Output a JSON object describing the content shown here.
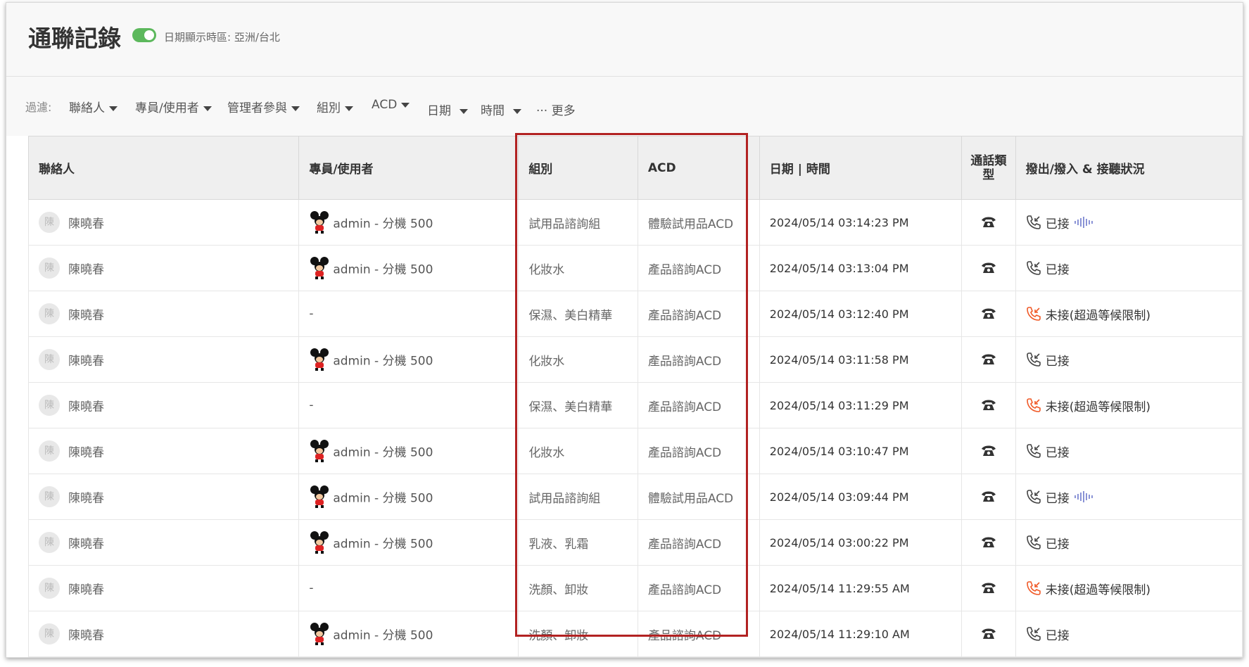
{
  "header": {
    "title": "通聯記錄",
    "timezone_label": "日期顯示時區: 亞洲/台北"
  },
  "filters": {
    "label": "過濾:",
    "items": [
      "聯絡人",
      "專員/使用者",
      "管理者參與",
      "組別",
      "ACD",
      "日期",
      "時間"
    ],
    "more": "··· 更多"
  },
  "table": {
    "columns": [
      "聯絡人",
      "專員/使用者",
      "組別",
      "ACD",
      "日期 | 時間",
      "通話類型",
      "撥出/撥入 & 接聽狀況"
    ],
    "rows": [
      {
        "avatar": "陳",
        "contact": "陳曉春",
        "agent": "admin - 分機 500",
        "has_agent_icon": true,
        "group": "試用品諮詢組",
        "acd": "體驗試用品ACD",
        "datetime": "2024/05/14 03:14:23 PM",
        "status": "已接",
        "missed": false,
        "recording": true
      },
      {
        "avatar": "陳",
        "contact": "陳曉春",
        "agent": "admin - 分機 500",
        "has_agent_icon": true,
        "group": "化妝水",
        "acd": "產品諮詢ACD",
        "datetime": "2024/05/14 03:13:04 PM",
        "status": "已接",
        "missed": false,
        "recording": false
      },
      {
        "avatar": "陳",
        "contact": "陳曉春",
        "agent": "-",
        "has_agent_icon": false,
        "group": "保濕、美白精華",
        "acd": "產品諮詢ACD",
        "datetime": "2024/05/14 03:12:40 PM",
        "status": "未接(超過等候限制)",
        "missed": true,
        "recording": false
      },
      {
        "avatar": "陳",
        "contact": "陳曉春",
        "agent": "admin - 分機 500",
        "has_agent_icon": true,
        "group": "化妝水",
        "acd": "產品諮詢ACD",
        "datetime": "2024/05/14 03:11:58 PM",
        "status": "已接",
        "missed": false,
        "recording": false
      },
      {
        "avatar": "陳",
        "contact": "陳曉春",
        "agent": "-",
        "has_agent_icon": false,
        "group": "保濕、美白精華",
        "acd": "產品諮詢ACD",
        "datetime": "2024/05/14 03:11:29 PM",
        "status": "未接(超過等候限制)",
        "missed": true,
        "recording": false
      },
      {
        "avatar": "陳",
        "contact": "陳曉春",
        "agent": "admin - 分機 500",
        "has_agent_icon": true,
        "group": "化妝水",
        "acd": "產品諮詢ACD",
        "datetime": "2024/05/14 03:10:47 PM",
        "status": "已接",
        "missed": false,
        "recording": false
      },
      {
        "avatar": "陳",
        "contact": "陳曉春",
        "agent": "admin - 分機 500",
        "has_agent_icon": true,
        "group": "試用品諮詢組",
        "acd": "體驗試用品ACD",
        "datetime": "2024/05/14 03:09:44 PM",
        "status": "已接",
        "missed": false,
        "recording": true
      },
      {
        "avatar": "陳",
        "contact": "陳曉春",
        "agent": "admin - 分機 500",
        "has_agent_icon": true,
        "group": "乳液、乳霜",
        "acd": "產品諮詢ACD",
        "datetime": "2024/05/14 03:00:22 PM",
        "status": "已接",
        "missed": false,
        "recording": false
      },
      {
        "avatar": "陳",
        "contact": "陳曉春",
        "agent": "-",
        "has_agent_icon": false,
        "group": "洗顏、卸妝",
        "acd": "產品諮詢ACD",
        "datetime": "2024/05/14 11:29:55 AM",
        "status": "未接(超過等候限制)",
        "missed": true,
        "recording": false
      },
      {
        "avatar": "陳",
        "contact": "陳曉春",
        "agent": "admin - 分機 500",
        "has_agent_icon": true,
        "group": "洗顏、卸妝",
        "acd": "產品諮詢ACD",
        "datetime": "2024/05/14 11:29:10 AM",
        "status": "已接",
        "missed": false,
        "recording": false
      }
    ]
  },
  "colors": {
    "toggle_on": "#5cb85c",
    "missed_call": "#f05a28",
    "recording_wave": "#8a93d6",
    "highlight_border": "#b22222"
  },
  "icons": {
    "agent": "mickey-avatar-icon",
    "call_type": "telephone-icon",
    "answered": "incoming-call-icon",
    "missed": "missed-call-icon",
    "recording": "sound-wave-icon"
  }
}
